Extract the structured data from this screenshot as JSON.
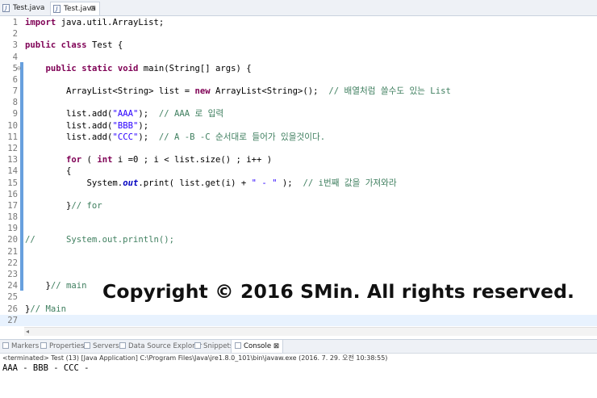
{
  "tabs": [
    {
      "label": "Test.java",
      "active": false
    },
    {
      "label": "Test.java",
      "active": true,
      "close": "⊠"
    }
  ],
  "editor": {
    "lines": [
      {
        "n": "1",
        "segs": [
          {
            "t": "import",
            "c": "kw"
          },
          {
            "t": " java.util.ArrayList;",
            "c": ""
          }
        ]
      },
      {
        "n": "2",
        "segs": []
      },
      {
        "n": "3",
        "segs": [
          {
            "t": "public",
            "c": "kw"
          },
          {
            "t": " ",
            "c": ""
          },
          {
            "t": "class",
            "c": "kw"
          },
          {
            "t": " Test {",
            "c": ""
          }
        ]
      },
      {
        "n": "4",
        "segs": []
      },
      {
        "n": "5",
        "segs": [
          {
            "t": "    ",
            "c": ""
          },
          {
            "t": "public",
            "c": "kw"
          },
          {
            "t": " ",
            "c": ""
          },
          {
            "t": "static",
            "c": "kw"
          },
          {
            "t": " ",
            "c": ""
          },
          {
            "t": "void",
            "c": "kw"
          },
          {
            "t": " main(String[] args) {",
            "c": ""
          }
        ]
      },
      {
        "n": "6",
        "segs": []
      },
      {
        "n": "7",
        "segs": [
          {
            "t": "        ArrayList<String> list = ",
            "c": ""
          },
          {
            "t": "new",
            "c": "kw"
          },
          {
            "t": " ArrayList<String>();  ",
            "c": ""
          },
          {
            "t": "// 배열처럼 쓸수도 있는 List",
            "c": "cm"
          }
        ]
      },
      {
        "n": "8",
        "segs": []
      },
      {
        "n": "9",
        "segs": [
          {
            "t": "        list.add(",
            "c": ""
          },
          {
            "t": "\"AAA\"",
            "c": "str"
          },
          {
            "t": ");  ",
            "c": ""
          },
          {
            "t": "// AAA 로 입력",
            "c": "cm"
          }
        ]
      },
      {
        "n": "10",
        "segs": [
          {
            "t": "        list.add(",
            "c": ""
          },
          {
            "t": "\"BBB\"",
            "c": "str"
          },
          {
            "t": ");",
            "c": ""
          }
        ]
      },
      {
        "n": "11",
        "segs": [
          {
            "t": "        list.add(",
            "c": ""
          },
          {
            "t": "\"CCC\"",
            "c": "str"
          },
          {
            "t": ");  ",
            "c": ""
          },
          {
            "t": "// A -B -C 순서대로 들어가 있을것이다.",
            "c": "cm"
          }
        ]
      },
      {
        "n": "12",
        "segs": []
      },
      {
        "n": "13",
        "segs": [
          {
            "t": "        ",
            "c": ""
          },
          {
            "t": "for",
            "c": "kw"
          },
          {
            "t": " ( ",
            "c": ""
          },
          {
            "t": "int",
            "c": "kw"
          },
          {
            "t": " i =0 ; i < list.size() ; i++ )",
            "c": ""
          }
        ]
      },
      {
        "n": "14",
        "segs": [
          {
            "t": "        {",
            "c": ""
          }
        ]
      },
      {
        "n": "15",
        "segs": [
          {
            "t": "            System.",
            "c": ""
          },
          {
            "t": "out",
            "c": "fld"
          },
          {
            "t": ".print( list.get(i) + ",
            "c": ""
          },
          {
            "t": "\" - \"",
            "c": "str"
          },
          {
            "t": " );  ",
            "c": ""
          },
          {
            "t": "// i번째 값을 가져와라",
            "c": "cm"
          }
        ]
      },
      {
        "n": "16",
        "segs": []
      },
      {
        "n": "17",
        "segs": [
          {
            "t": "        }",
            "c": ""
          },
          {
            "t": "// for",
            "c": "cm"
          }
        ]
      },
      {
        "n": "18",
        "segs": []
      },
      {
        "n": "19",
        "segs": []
      },
      {
        "n": "20",
        "segs": [
          {
            "t": "//      System.out.println();",
            "c": "cm"
          }
        ]
      },
      {
        "n": "21",
        "segs": []
      },
      {
        "n": "22",
        "segs": []
      },
      {
        "n": "23",
        "segs": []
      },
      {
        "n": "24",
        "segs": [
          {
            "t": "    }",
            "c": ""
          },
          {
            "t": "// main",
            "c": "cm"
          }
        ]
      },
      {
        "n": "25",
        "segs": []
      },
      {
        "n": "26",
        "segs": [
          {
            "t": "}",
            "c": ""
          },
          {
            "t": "// Main",
            "c": "cm"
          }
        ]
      },
      {
        "n": "27",
        "segs": []
      }
    ],
    "current_line": "27",
    "fold_marker": "⊖"
  },
  "views": [
    {
      "label": "Markers",
      "active": false
    },
    {
      "label": "Properties",
      "active": false
    },
    {
      "label": "Servers",
      "active": false
    },
    {
      "label": "Data Source Explorer",
      "active": false
    },
    {
      "label": "Snippets",
      "active": false
    },
    {
      "label": "Console",
      "active": true,
      "close": "⊠"
    }
  ],
  "console": {
    "status": "<terminated> Test (13) [Java Application] C:\\Program Files\\Java\\jre1.8.0_101\\bin\\javaw.exe (2016. 7. 29. 오전 10:38:55)",
    "output": "AAA - BBB - CCC -"
  },
  "watermark": "Copyright © 2016 SMin. All rights reserved.",
  "colors": {
    "keyword": "#7f0055",
    "string": "#2a00ff",
    "comment": "#3f7f5f",
    "field": "#0000c0"
  }
}
